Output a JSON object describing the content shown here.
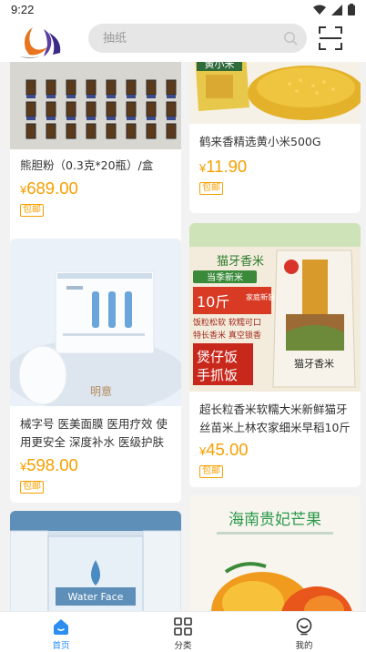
{
  "status_bar": {
    "time": "9:22"
  },
  "header": {
    "search_placeholder": "抽纸"
  },
  "products": [
    {
      "title": "熊胆粉（0.3克*20瓶）/盒",
      "currency": "¥",
      "price": "689.00",
      "tag": "包邮"
    },
    {
      "title": "鹤来香精选黄小米500G",
      "currency": "¥",
      "price": "11.90",
      "tag": "包邮",
      "img_text": "黄小米"
    },
    {
      "title": "械字号 医美面膜 医用疗效 使用更安全 深度补水 医级护肤 舒…",
      "currency": "¥",
      "price": "598.00",
      "tag": "包邮",
      "img_text": "明意"
    },
    {
      "title": "超长粒香米软糯大米新鲜猫牙丝苗米上林农家细米早稻10斤",
      "currency": "¥",
      "price": "45.00",
      "tag": "包邮",
      "img_texts": {
        "brand": "猫牙香米",
        "season": "当季新米",
        "pack": "10斤",
        "pack_note": "家庭新装",
        "feature": "饭粒松软 软糯可口",
        "origin": "特长香米 真空锁香",
        "promo1": "煲仔饭",
        "promo2": "手抓饭",
        "bag_title": "猫牙香米"
      }
    },
    {
      "img_text": "Water Face"
    },
    {
      "img_text": "海南贵妃芒果"
    }
  ],
  "bottom_nav": [
    {
      "label": "首页",
      "icon": "home-icon",
      "active": true
    },
    {
      "label": "分类",
      "icon": "grid-icon",
      "active": false
    },
    {
      "label": "我的",
      "icon": "profile-icon",
      "active": false
    }
  ],
  "colors": {
    "price": "#f5a000",
    "nav_active": "#2b8ef0"
  }
}
